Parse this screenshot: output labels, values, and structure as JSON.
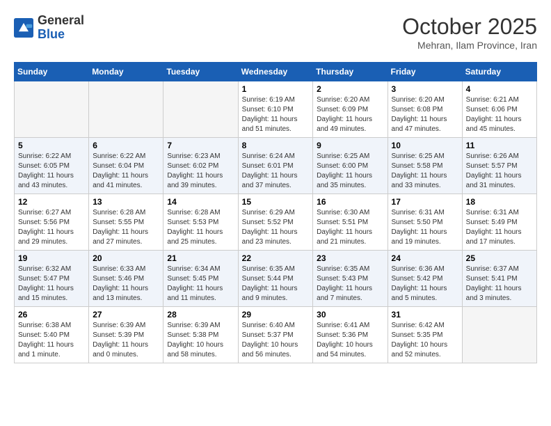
{
  "header": {
    "logo_general": "General",
    "logo_blue": "Blue",
    "month_title": "October 2025",
    "subtitle": "Mehran, Ilam Province, Iran"
  },
  "days_of_week": [
    "Sunday",
    "Monday",
    "Tuesday",
    "Wednesday",
    "Thursday",
    "Friday",
    "Saturday"
  ],
  "weeks": [
    {
      "shaded": false,
      "days": [
        {
          "num": "",
          "info": ""
        },
        {
          "num": "",
          "info": ""
        },
        {
          "num": "",
          "info": ""
        },
        {
          "num": "1",
          "info": "Sunrise: 6:19 AM\nSunset: 6:10 PM\nDaylight: 11 hours\nand 51 minutes."
        },
        {
          "num": "2",
          "info": "Sunrise: 6:20 AM\nSunset: 6:09 PM\nDaylight: 11 hours\nand 49 minutes."
        },
        {
          "num": "3",
          "info": "Sunrise: 6:20 AM\nSunset: 6:08 PM\nDaylight: 11 hours\nand 47 minutes."
        },
        {
          "num": "4",
          "info": "Sunrise: 6:21 AM\nSunset: 6:06 PM\nDaylight: 11 hours\nand 45 minutes."
        }
      ]
    },
    {
      "shaded": true,
      "days": [
        {
          "num": "5",
          "info": "Sunrise: 6:22 AM\nSunset: 6:05 PM\nDaylight: 11 hours\nand 43 minutes."
        },
        {
          "num": "6",
          "info": "Sunrise: 6:22 AM\nSunset: 6:04 PM\nDaylight: 11 hours\nand 41 minutes."
        },
        {
          "num": "7",
          "info": "Sunrise: 6:23 AM\nSunset: 6:02 PM\nDaylight: 11 hours\nand 39 minutes."
        },
        {
          "num": "8",
          "info": "Sunrise: 6:24 AM\nSunset: 6:01 PM\nDaylight: 11 hours\nand 37 minutes."
        },
        {
          "num": "9",
          "info": "Sunrise: 6:25 AM\nSunset: 6:00 PM\nDaylight: 11 hours\nand 35 minutes."
        },
        {
          "num": "10",
          "info": "Sunrise: 6:25 AM\nSunset: 5:58 PM\nDaylight: 11 hours\nand 33 minutes."
        },
        {
          "num": "11",
          "info": "Sunrise: 6:26 AM\nSunset: 5:57 PM\nDaylight: 11 hours\nand 31 minutes."
        }
      ]
    },
    {
      "shaded": false,
      "days": [
        {
          "num": "12",
          "info": "Sunrise: 6:27 AM\nSunset: 5:56 PM\nDaylight: 11 hours\nand 29 minutes."
        },
        {
          "num": "13",
          "info": "Sunrise: 6:28 AM\nSunset: 5:55 PM\nDaylight: 11 hours\nand 27 minutes."
        },
        {
          "num": "14",
          "info": "Sunrise: 6:28 AM\nSunset: 5:53 PM\nDaylight: 11 hours\nand 25 minutes."
        },
        {
          "num": "15",
          "info": "Sunrise: 6:29 AM\nSunset: 5:52 PM\nDaylight: 11 hours\nand 23 minutes."
        },
        {
          "num": "16",
          "info": "Sunrise: 6:30 AM\nSunset: 5:51 PM\nDaylight: 11 hours\nand 21 minutes."
        },
        {
          "num": "17",
          "info": "Sunrise: 6:31 AM\nSunset: 5:50 PM\nDaylight: 11 hours\nand 19 minutes."
        },
        {
          "num": "18",
          "info": "Sunrise: 6:31 AM\nSunset: 5:49 PM\nDaylight: 11 hours\nand 17 minutes."
        }
      ]
    },
    {
      "shaded": true,
      "days": [
        {
          "num": "19",
          "info": "Sunrise: 6:32 AM\nSunset: 5:47 PM\nDaylight: 11 hours\nand 15 minutes."
        },
        {
          "num": "20",
          "info": "Sunrise: 6:33 AM\nSunset: 5:46 PM\nDaylight: 11 hours\nand 13 minutes."
        },
        {
          "num": "21",
          "info": "Sunrise: 6:34 AM\nSunset: 5:45 PM\nDaylight: 11 hours\nand 11 minutes."
        },
        {
          "num": "22",
          "info": "Sunrise: 6:35 AM\nSunset: 5:44 PM\nDaylight: 11 hours\nand 9 minutes."
        },
        {
          "num": "23",
          "info": "Sunrise: 6:35 AM\nSunset: 5:43 PM\nDaylight: 11 hours\nand 7 minutes."
        },
        {
          "num": "24",
          "info": "Sunrise: 6:36 AM\nSunset: 5:42 PM\nDaylight: 11 hours\nand 5 minutes."
        },
        {
          "num": "25",
          "info": "Sunrise: 6:37 AM\nSunset: 5:41 PM\nDaylight: 11 hours\nand 3 minutes."
        }
      ]
    },
    {
      "shaded": false,
      "days": [
        {
          "num": "26",
          "info": "Sunrise: 6:38 AM\nSunset: 5:40 PM\nDaylight: 11 hours\nand 1 minute."
        },
        {
          "num": "27",
          "info": "Sunrise: 6:39 AM\nSunset: 5:39 PM\nDaylight: 11 hours\nand 0 minutes."
        },
        {
          "num": "28",
          "info": "Sunrise: 6:39 AM\nSunset: 5:38 PM\nDaylight: 10 hours\nand 58 minutes."
        },
        {
          "num": "29",
          "info": "Sunrise: 6:40 AM\nSunset: 5:37 PM\nDaylight: 10 hours\nand 56 minutes."
        },
        {
          "num": "30",
          "info": "Sunrise: 6:41 AM\nSunset: 5:36 PM\nDaylight: 10 hours\nand 54 minutes."
        },
        {
          "num": "31",
          "info": "Sunrise: 6:42 AM\nSunset: 5:35 PM\nDaylight: 10 hours\nand 52 minutes."
        },
        {
          "num": "",
          "info": ""
        }
      ]
    }
  ]
}
